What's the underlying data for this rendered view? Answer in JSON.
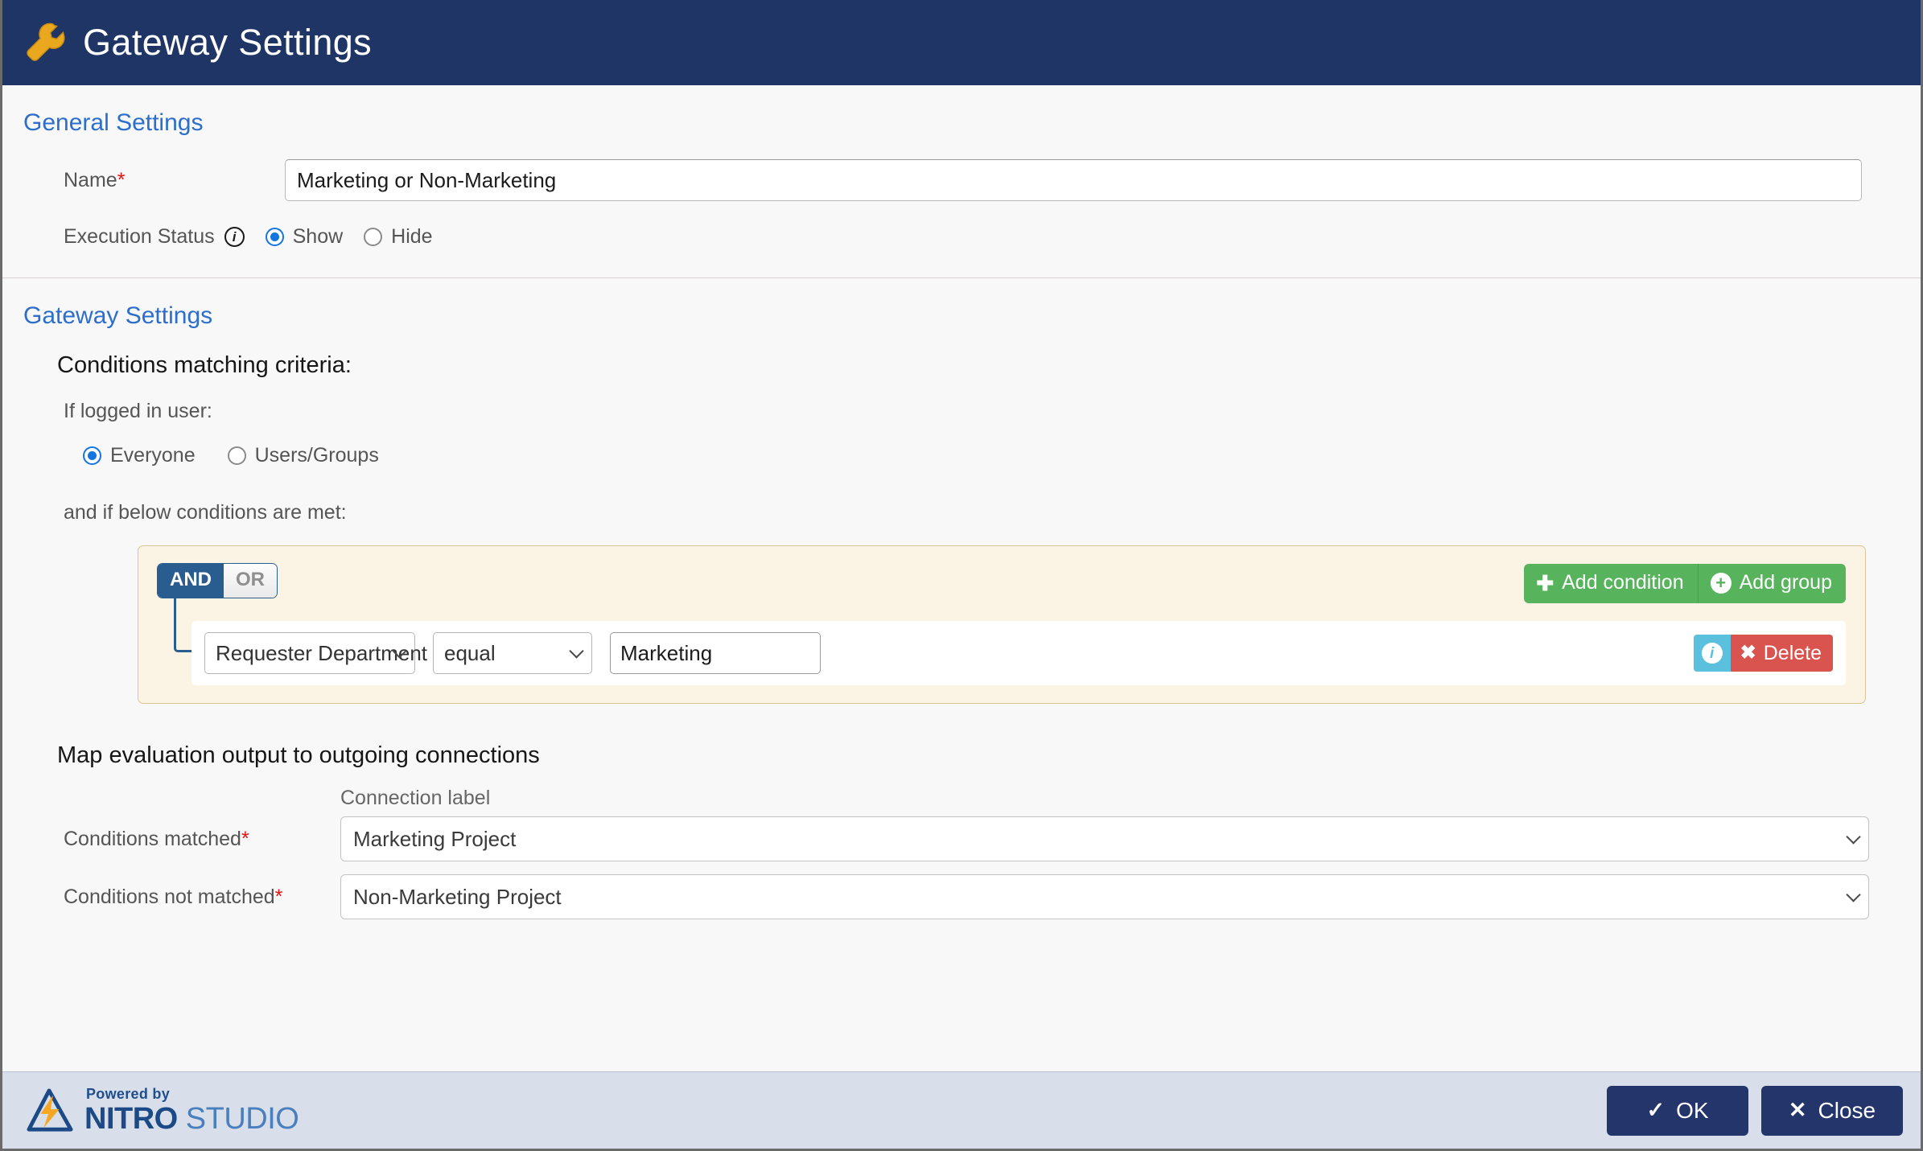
{
  "window": {
    "title": "Gateway Settings",
    "title_icon": "wrench-icon"
  },
  "general_settings": {
    "heading": "General Settings",
    "name": {
      "label": "Name",
      "required_marker": "*",
      "value": "Marketing or Non-Marketing"
    },
    "execution_status": {
      "label": "Execution Status",
      "info_icon": "info-icon",
      "options": [
        {
          "label": "Show",
          "selected": true
        },
        {
          "label": "Hide",
          "selected": false
        }
      ]
    }
  },
  "gateway_settings": {
    "heading": "Gateway Settings",
    "criteria_heading": "Conditions matching criteria:",
    "logged_in_user_label": "If logged in user:",
    "user_scope_options": [
      {
        "label": "Everyone",
        "selected": true
      },
      {
        "label": "Users/Groups",
        "selected": false
      }
    ],
    "conditions_note": "and if below conditions are met:",
    "query_builder": {
      "logic": {
        "and_label": "AND",
        "or_label": "OR",
        "active": "AND"
      },
      "actions": [
        {
          "label": "Add condition",
          "icon": "plus-icon"
        },
        {
          "label": "Add group",
          "icon": "circle-plus-icon"
        }
      ],
      "rules": [
        {
          "field": "Requester Department",
          "operator": "equal",
          "value": "Marketing",
          "info_label": "i",
          "delete_label": "Delete"
        }
      ]
    }
  },
  "map_output": {
    "heading": "Map evaluation output to outgoing connections",
    "column_header": "Connection label",
    "rows": [
      {
        "label": "Conditions matched",
        "required_marker": "*",
        "value": "Marketing Project"
      },
      {
        "label": "Conditions not matched",
        "required_marker": "*",
        "value": "Non-Marketing Project"
      }
    ]
  },
  "footer": {
    "logo": {
      "powered_by": "Powered by",
      "brand_bold": "NITRO",
      "brand_light": " STUDIO"
    },
    "buttons": [
      {
        "label": "OK",
        "icon": "check-icon"
      },
      {
        "label": "Close",
        "icon": "close-icon"
      }
    ]
  },
  "colors": {
    "titlebar": "#1f3566",
    "heading_blue": "#2c6ecb",
    "accent_gold": "#eaa81e",
    "required_red": "#e81010",
    "query_box_bg": "#fbf3e4",
    "green_action": "#57b45c",
    "delete_red": "#d9534f",
    "info_blue": "#5bc0de",
    "footer_bg": "#d9dfea"
  }
}
